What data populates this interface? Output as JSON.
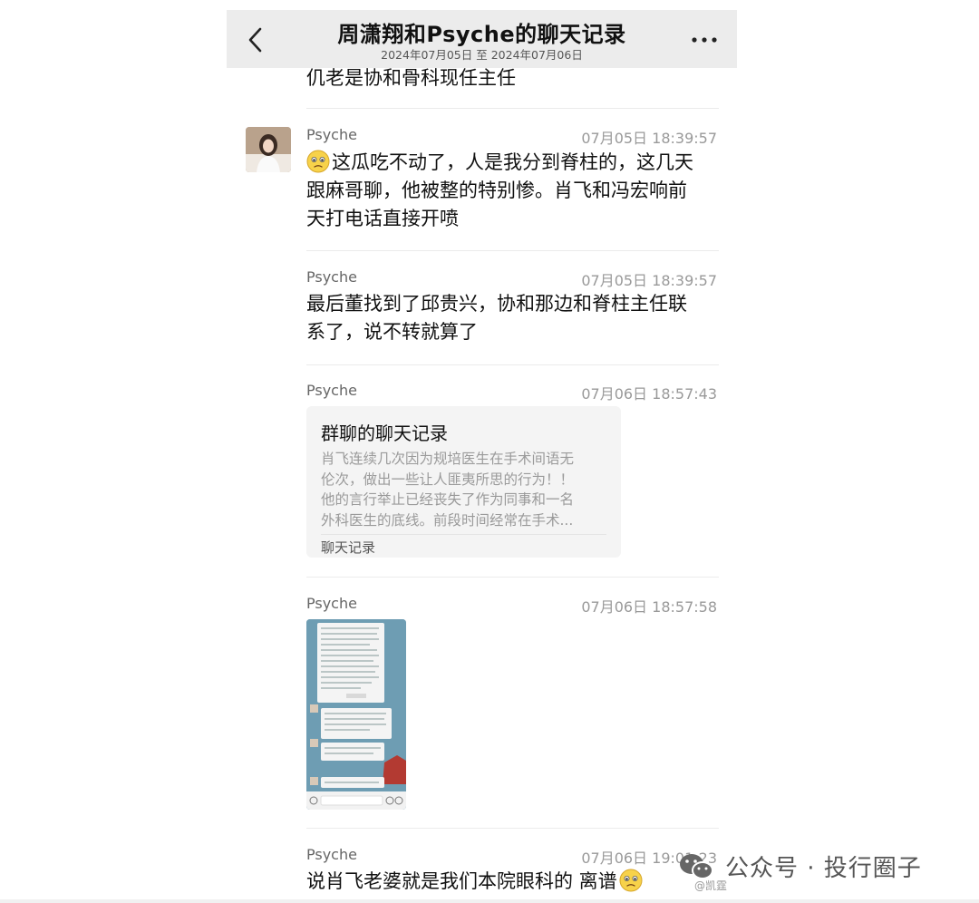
{
  "header": {
    "title": "周潇翔和Psyche的聊天记录",
    "subtitle": "2024年07月05日 至 2024年07月06日",
    "back_icon": "chevron-left-icon",
    "more_icon": "ellipsis-icon"
  },
  "messages": [
    {
      "text": "仉老是协和骨科现任主任"
    },
    {
      "sender": "Psyche",
      "time": "07月05日 18:39:57",
      "emoji": "worried-face-emoji",
      "lines": [
        "这瓜吃不动了，人是我分到脊柱的，这几天",
        "跟麻哥聊，他被整的特别惨。肖飞和冯宏响前",
        "天打电话直接开喷"
      ]
    },
    {
      "sender": "Psyche",
      "time": "07月05日 18:39:57",
      "lines": [
        "最后董找到了邱贵兴，协和那边和脊柱主任联",
        "系了，说不转就算了"
      ]
    },
    {
      "sender": "Psyche",
      "time": "07月06日 18:57:43",
      "card": {
        "title": "群聊的聊天记录",
        "preview": [
          "肖飞连续几次因为规培医生在手术间语无",
          "伦次，做出一些让人匪夷所思的行为！！",
          "他的言行举止已经丧失了作为同事和一名",
          "外科医生的底线。前段时间经常在手术..."
        ],
        "footer": "聊天记录"
      }
    },
    {
      "sender": "Psyche",
      "time": "07月06日 18:57:58",
      "image": "chat-screenshot-thumbnail"
    },
    {
      "sender": "Psyche",
      "time": "07月06日 19:01:23",
      "text": "说肖飞老婆就是我们本院眼科的 离谱",
      "emoji": "worried-face-emoji"
    }
  ],
  "watermark": {
    "text": "公众号 · 投行圈子",
    "icon": "wechat-icon",
    "small": "@凯霆"
  },
  "colors": {
    "header_bg": "#ececec",
    "card_bg": "#f4f4f4",
    "time_text": "#999999"
  }
}
